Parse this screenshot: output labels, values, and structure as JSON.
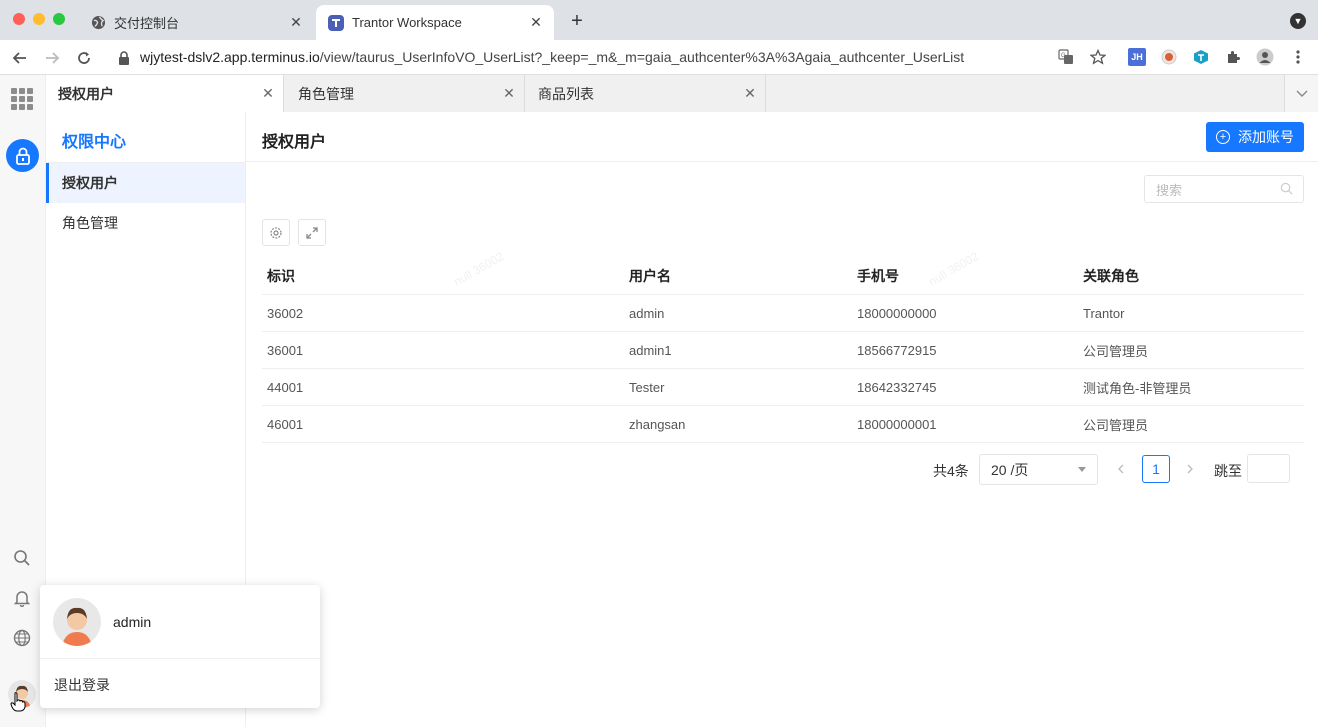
{
  "browser": {
    "tabs": [
      {
        "title": "交付控制台"
      },
      {
        "title": "Trantor Workspace"
      }
    ],
    "url": {
      "host": "wjytest-dslv2.app.terminus.io",
      "path": "/view/taurus_UserInfoVO_UserList?_keep=_m&_m=gaia_authcenter%3A%3Agaia_authcenter_UserList"
    },
    "extensions": {
      "jh_label": "JH"
    }
  },
  "page_tabs": [
    {
      "label": "授权用户"
    },
    {
      "label": "角色管理"
    },
    {
      "label": "商品列表"
    }
  ],
  "sidebar": {
    "title": "权限中心",
    "items": [
      {
        "label": "授权用户"
      },
      {
        "label": "角色管理"
      }
    ]
  },
  "main": {
    "title": "授权用户",
    "add_button": "添加账号",
    "search_placeholder": "搜索",
    "table": {
      "columns": [
        "标识",
        "用户名",
        "手机号",
        "关联角色"
      ],
      "rows": [
        [
          "36002",
          "admin",
          "18000000000",
          "Trantor"
        ],
        [
          "36001",
          "admin1",
          "18566772915",
          "公司管理员"
        ],
        [
          "44001",
          "Tester",
          "18642332745",
          "测试角色-非管理员"
        ],
        [
          "46001",
          "zhangsan",
          "18000000001",
          "公司管理员"
        ]
      ]
    },
    "pagination": {
      "total": "共4条",
      "page_size": "20 /页",
      "current_page": "1",
      "jump_label": "跳至"
    },
    "watermark": "null 36002"
  },
  "user_popover": {
    "name": "admin",
    "logout": "退出登录"
  },
  "colors": {
    "primary": "#1677ff",
    "tabbar": "#dee1e6"
  }
}
